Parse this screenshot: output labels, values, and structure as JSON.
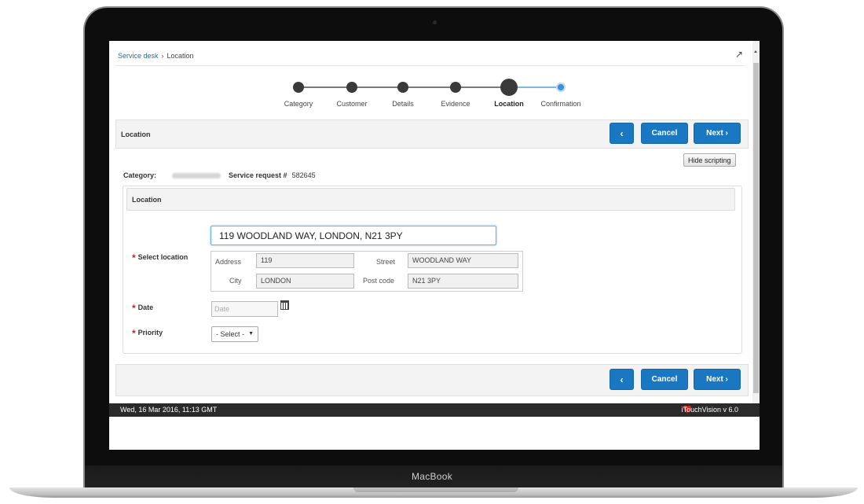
{
  "device": {
    "brand": "MacBook"
  },
  "breadcrumb": {
    "root": "Service desk",
    "separator": "›",
    "current": "Location"
  },
  "stepper": {
    "steps": [
      {
        "label": "Category",
        "state": "done"
      },
      {
        "label": "Customer",
        "state": "done"
      },
      {
        "label": "Details",
        "state": "done"
      },
      {
        "label": "Evidence",
        "state": "done"
      },
      {
        "label": "Location",
        "state": "current"
      },
      {
        "label": "Confirmation",
        "state": "pending"
      }
    ]
  },
  "header_panel": {
    "title": "Location"
  },
  "nav": {
    "back_symbol": "‹",
    "cancel_label": "Cancel",
    "next_label": "Next ›"
  },
  "hide_scripting_label": "Hide scripting",
  "meta": {
    "category_label": "Category:",
    "service_request_label": "Service request #",
    "service_request_number": "582645"
  },
  "location_section": {
    "title": "Location"
  },
  "form": {
    "address_search_value": "119 WOODLAND WAY, LONDON, N21 3PY",
    "select_location_label": "Select location",
    "address": {
      "address_label": "Address",
      "address_value": "119",
      "street_label": "Street",
      "street_value": "WOODLAND WAY",
      "city_label": "City",
      "city_value": "LONDON",
      "postcode_label": "Post code",
      "postcode_value": "N21 3PY"
    },
    "date_label": "Date",
    "date_placeholder": "Date",
    "priority_label": "Priority",
    "priority_selected": "- Select -"
  },
  "status_bar": {
    "timestamp": "Wed, 16 Mar 2016, 11:13 GMT",
    "version": "iTouchVision v 6.0"
  },
  "colors": {
    "primary": "#1a78c2",
    "required": "#d21f1f",
    "step_current": "#3a3a3a",
    "step_pending": "#3d8fd6",
    "status_bar": "#2a2a2a"
  },
  "icons": [
    "collapse-icon",
    "calendar-icon",
    "heart-icon",
    "chevron-left-icon",
    "chevron-right-icon"
  ]
}
